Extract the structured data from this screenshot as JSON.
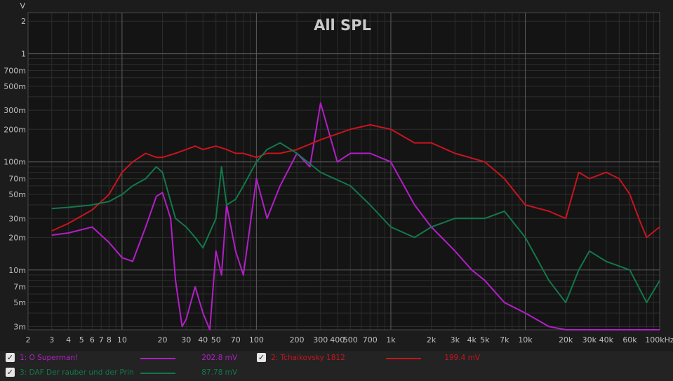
{
  "chart_data": {
    "type": "line",
    "title": "All SPL",
    "ylabel": "V",
    "xlabel": "",
    "xscale": "log",
    "yscale": "log",
    "xlim": [
      2,
      100000
    ],
    "ylim": [
      0.0028,
      2.4
    ],
    "grid": true,
    "legend_position": "bottom",
    "x_ticks": [
      2,
      3,
      4,
      5,
      6,
      7,
      8,
      10,
      20,
      30,
      40,
      50,
      70,
      100,
      200,
      300,
      400,
      500,
      700,
      1000,
      2000,
      3000,
      4000,
      5000,
      7000,
      10000,
      20000,
      30000,
      40000,
      60000,
      100000
    ],
    "x_tick_labels": [
      "2",
      "3",
      "4",
      "5",
      "6",
      "7",
      "8",
      "10",
      "20",
      "30",
      "40",
      "50",
      "70",
      "100",
      "200",
      "300",
      "400",
      "500",
      "700",
      "1k",
      "2k",
      "3k",
      "4k",
      "5k",
      "7k",
      "10k",
      "20k",
      "30k",
      "40k",
      "60k",
      "100kHz"
    ],
    "y_ticks": [
      2,
      1,
      0.7,
      0.5,
      0.3,
      0.2,
      0.1,
      0.07,
      0.05,
      0.03,
      0.02,
      0.01,
      0.007,
      0.005,
      0.003
    ],
    "y_tick_labels": [
      "2",
      "1",
      "700m",
      "500m",
      "300m",
      "200m",
      "100m",
      "70m",
      "50m",
      "30m",
      "20m",
      "10m",
      "7m",
      "5m",
      "3m"
    ],
    "series": [
      {
        "name": "1: O Superman!",
        "color": "#b31ec8",
        "value_label": "202.8 mV",
        "x": [
          3,
          4,
          6,
          8,
          10,
          12,
          15,
          18,
          20,
          23,
          25,
          28,
          30,
          35,
          40,
          45,
          50,
          55,
          60,
          70,
          80,
          100,
          120,
          150,
          200,
          250,
          300,
          400,
          500,
          700,
          1000,
          1500,
          2000,
          3000,
          4000,
          5000,
          7000,
          10000,
          15000,
          20000,
          30000,
          50000,
          80000,
          100000
        ],
        "y": [
          0.021,
          0.022,
          0.025,
          0.018,
          0.013,
          0.012,
          0.025,
          0.048,
          0.052,
          0.03,
          0.008,
          0.003,
          0.0035,
          0.007,
          0.004,
          0.002,
          0.015,
          0.009,
          0.04,
          0.015,
          0.009,
          0.07,
          0.03,
          0.06,
          0.12,
          0.09,
          0.35,
          0.1,
          0.12,
          0.12,
          0.1,
          0.04,
          0.025,
          0.015,
          0.01,
          0.008,
          0.005,
          0.004,
          0.003,
          0.0025,
          0.002,
          0.002,
          0.002,
          0.002
        ]
      },
      {
        "name": "2: Tchaikovsky 1812",
        "color": "#c8141e",
        "value_label": "199.4 mV",
        "x": [
          3,
          4,
          6,
          8,
          10,
          12,
          15,
          18,
          20,
          25,
          30,
          35,
          40,
          50,
          60,
          70,
          80,
          100,
          120,
          150,
          200,
          300,
          500,
          700,
          1000,
          1500,
          2000,
          3000,
          5000,
          7000,
          10000,
          15000,
          20000,
          25000,
          30000,
          40000,
          50000,
          60000,
          70000,
          80000,
          100000
        ],
        "y": [
          0.023,
          0.027,
          0.036,
          0.05,
          0.08,
          0.1,
          0.12,
          0.11,
          0.11,
          0.12,
          0.13,
          0.14,
          0.13,
          0.14,
          0.13,
          0.12,
          0.12,
          0.11,
          0.12,
          0.12,
          0.13,
          0.16,
          0.2,
          0.22,
          0.2,
          0.15,
          0.15,
          0.12,
          0.1,
          0.07,
          0.04,
          0.035,
          0.03,
          0.08,
          0.07,
          0.08,
          0.07,
          0.05,
          0.03,
          0.02,
          0.025
        ]
      },
      {
        "name": "3: DAF Der rauber und der Prin",
        "color": "#12784a",
        "value_label": "87.78 mV",
        "x": [
          3,
          4,
          6,
          8,
          10,
          12,
          15,
          18,
          20,
          25,
          30,
          35,
          40,
          50,
          55,
          60,
          70,
          80,
          100,
          120,
          150,
          200,
          300,
          500,
          700,
          1000,
          1500,
          2000,
          3000,
          5000,
          7000,
          10000,
          15000,
          20000,
          25000,
          30000,
          40000,
          60000,
          80000,
          100000
        ],
        "y": [
          0.037,
          0.038,
          0.04,
          0.043,
          0.05,
          0.06,
          0.07,
          0.09,
          0.08,
          0.03,
          0.025,
          0.02,
          0.016,
          0.03,
          0.09,
          0.04,
          0.045,
          0.06,
          0.1,
          0.13,
          0.15,
          0.12,
          0.08,
          0.06,
          0.04,
          0.025,
          0.02,
          0.025,
          0.03,
          0.03,
          0.035,
          0.02,
          0.008,
          0.005,
          0.01,
          0.015,
          0.012,
          0.01,
          0.005,
          0.008
        ]
      }
    ]
  },
  "legend": {
    "items": [
      {
        "label": "1: O Superman!",
        "value": "202.8 mV",
        "color": "#b31ec8"
      },
      {
        "label": "2: Tchaikovsky 1812",
        "value": "199.4 mV",
        "color": "#c8141e"
      },
      {
        "label": "3: DAF Der rauber und der Prin",
        "value": "87.78 mV",
        "color": "#12784a"
      }
    ]
  }
}
